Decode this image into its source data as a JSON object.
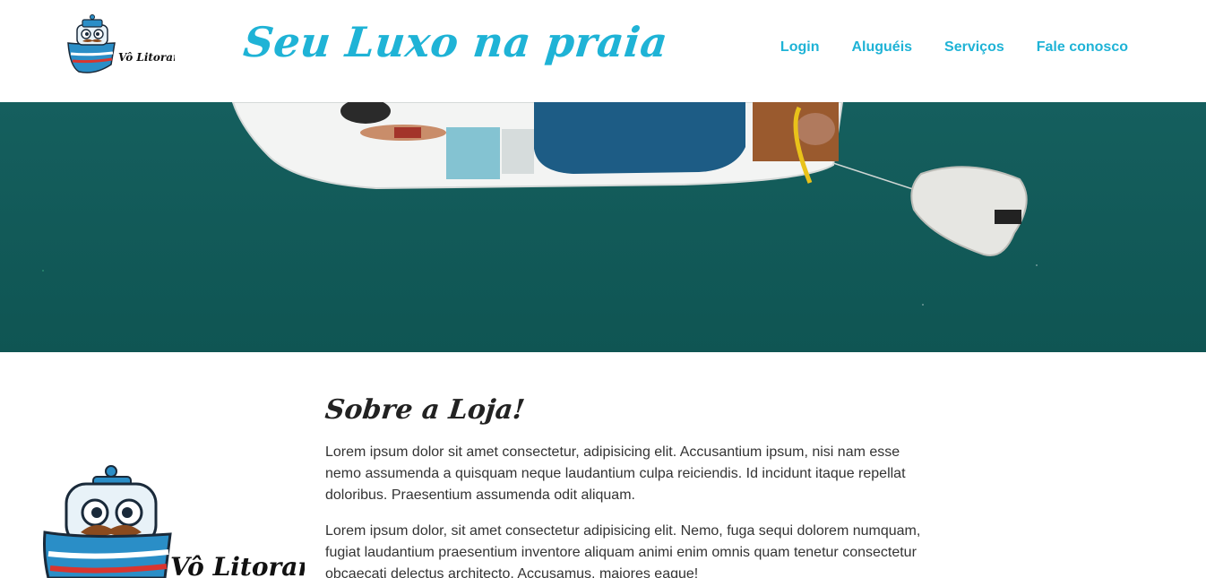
{
  "header": {
    "logo_text": "Vô Litorar!",
    "tagline": "Seu Luxo na praia",
    "nav": [
      {
        "label": "Login"
      },
      {
        "label": "Aluguéis"
      },
      {
        "label": "Serviços"
      },
      {
        "label": "Fale conosco"
      }
    ]
  },
  "about": {
    "title": "Sobre a Loja!",
    "paragraphs": [
      "Lorem ipsum dolor sit amet consectetur, adipisicing elit. Accusantium ipsum, nisi nam esse nemo assumenda a quisquam neque laudantium culpa reiciendis. Id incidunt itaque repellat doloribus. Praesentium assumenda odit aliquam.",
      "Lorem ipsum dolor, sit amet consectetur adipisicing elit. Nemo, fuga sequi dolorem numquam, fugiat laudantium praesentium inventore aliquam animi enim omnis quam tenetur consectetur obcaecati delectus architecto. Accusamus, maiores eaque!"
    ]
  },
  "side_logo_text": "Vô Litorar!",
  "colors": {
    "accent": "#1fb3d6",
    "sea": "#145f5d"
  }
}
